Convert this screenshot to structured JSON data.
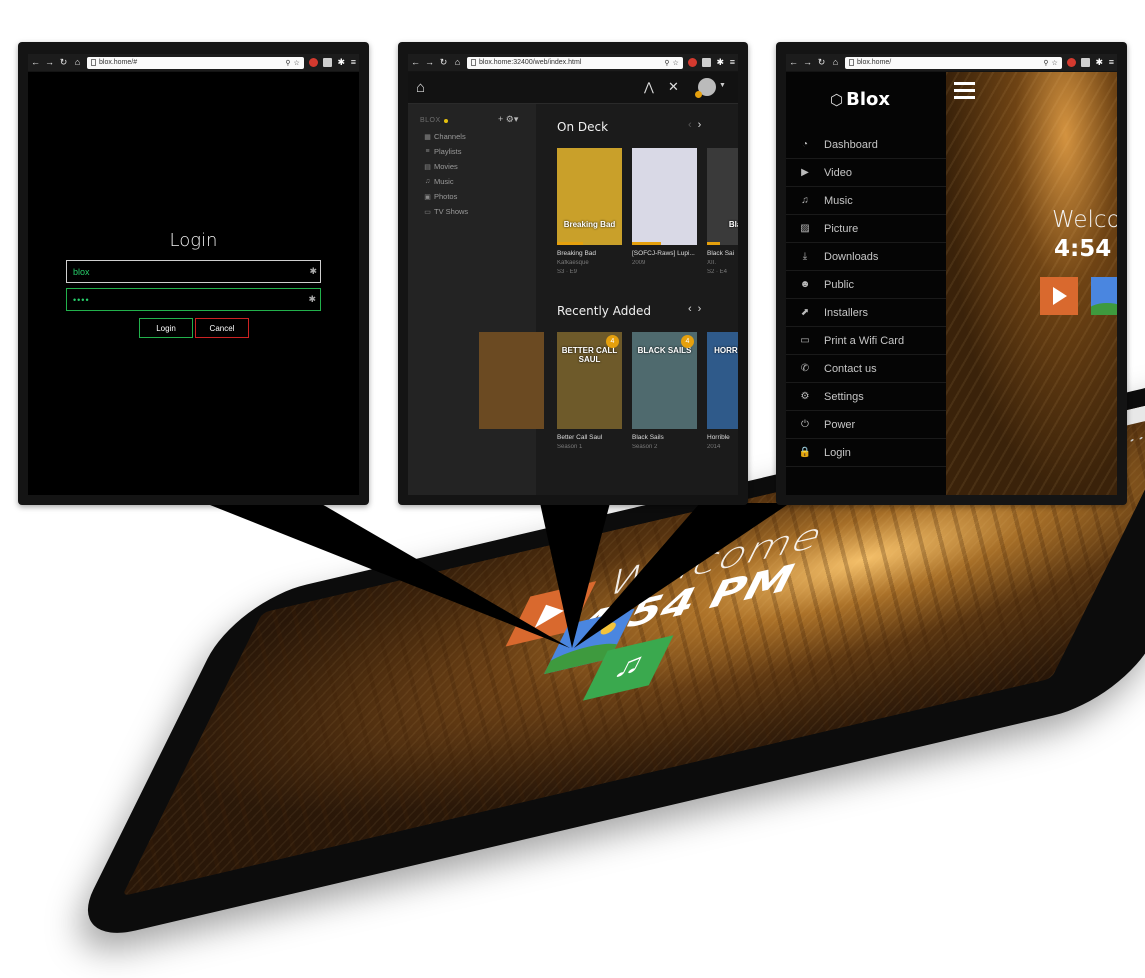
{
  "tablet": {
    "welcome": "Welcome",
    "time": "4:54 PM",
    "tiles": [
      "play-tile",
      "picture-tile",
      "music-tile"
    ]
  },
  "login_window": {
    "url": "blox.home/#",
    "title": "Login",
    "username_value": "blox",
    "password_value": "••••",
    "login_button": "Login",
    "cancel_button": "Cancel"
  },
  "plex_window": {
    "url": "blox.home:32400/web/index.html",
    "server_name": "BLOX",
    "libraries": [
      {
        "icon": "channels-icon",
        "label": "Channels"
      },
      {
        "icon": "playlists-icon",
        "label": "Playlists"
      },
      {
        "icon": "movies-icon",
        "label": "Movies"
      },
      {
        "icon": "music-icon",
        "label": "Music"
      },
      {
        "icon": "photos-icon",
        "label": "Photos"
      },
      {
        "icon": "tv-shows-icon",
        "label": "TV Shows"
      }
    ],
    "on_deck": {
      "title": "On Deck",
      "items": [
        {
          "title": "Breaking Bad",
          "line1": "Kafkaesque",
          "line2": "S3 · E9",
          "poster_text": "Breaking Bad",
          "progress": 0.4
        },
        {
          "title": "[SOFCJ-Raws] Lupi...",
          "line1": "2009",
          "line2": "",
          "poster_text": "",
          "progress": 0.45
        },
        {
          "title": "Black Sai",
          "line1": "XII.",
          "line2": "S2 · E4",
          "poster_text": "Black",
          "progress": 0.2
        }
      ]
    },
    "recently_added": {
      "title": "Recently Added",
      "items": [
        {
          "title": "Better Call Saul",
          "line1": "Season 1",
          "badge": "4",
          "poster_text": "BETTER CALL SAUL"
        },
        {
          "title": "Black Sails",
          "line1": "Season 2",
          "badge": "4",
          "poster_text": "BLACK SAILS"
        },
        {
          "title": "Horrible",
          "line1": "2014",
          "badge": "",
          "poster_text": "HORRI BOSS"
        }
      ]
    }
  },
  "blox_window": {
    "url": "blox.home/",
    "logo_text": "Blox",
    "welcome": "Welco",
    "time": "4:54",
    "menu": [
      {
        "icon": "dashboard-icon",
        "label": "Dashboard"
      },
      {
        "icon": "video-icon",
        "label": "Video"
      },
      {
        "icon": "music-icon",
        "label": "Music"
      },
      {
        "icon": "picture-icon",
        "label": "Picture"
      },
      {
        "icon": "downloads-icon",
        "label": "Downloads"
      },
      {
        "icon": "public-icon",
        "label": "Public"
      },
      {
        "icon": "installers-icon",
        "label": "Installers"
      },
      {
        "icon": "wifi-card-icon",
        "label": "Print a Wifi Card"
      },
      {
        "icon": "phone-icon",
        "label": "Contact us"
      },
      {
        "icon": "settings-icon",
        "label": "Settings"
      },
      {
        "icon": "power-icon",
        "label": "Power"
      },
      {
        "icon": "lock-icon",
        "label": "Login"
      }
    ]
  },
  "colors": {
    "accent_green": "#22b14c",
    "accent_red": "#cc2222",
    "plex_orange": "#e5a00d",
    "tile_orange": "#d9692e",
    "tile_blue": "#4a86e0",
    "tile_green": "#3aa94e"
  }
}
